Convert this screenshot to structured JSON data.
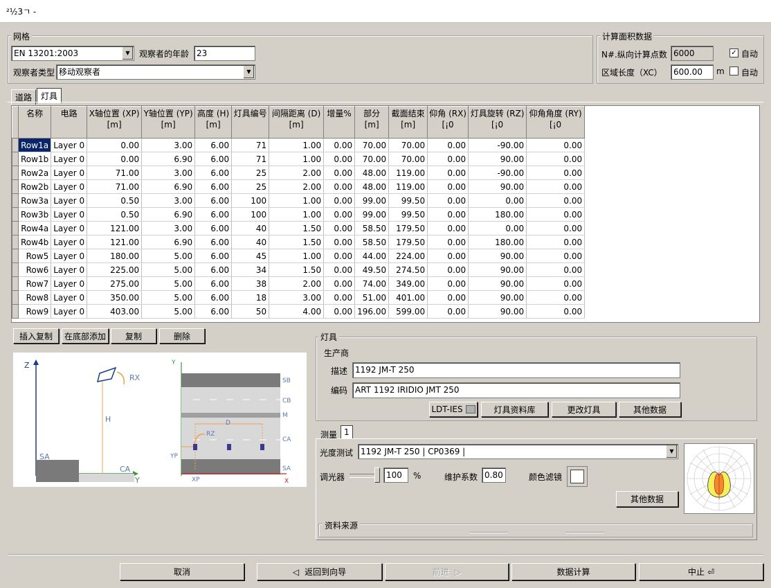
{
  "window": {
    "title": "²½3ㄱ -"
  },
  "grid_group": {
    "title": "网格",
    "standard": "EN 13201:2003",
    "observer_age_label": "观察者的年龄",
    "observer_age": "23",
    "observer_type_label": "观察者类型",
    "observer_type": "移动观察者"
  },
  "calc_group": {
    "title": "计算面积数据",
    "points_label": "N#.纵向计算点数",
    "points_value": "6000",
    "auto1": "自动",
    "auto1_checked": "✓",
    "length_label": "区域长度（XC）",
    "length_value": "600.00",
    "length_unit": "m",
    "auto2": "自动"
  },
  "tabs": [
    "道路",
    "灯具"
  ],
  "table": {
    "columns": [
      {
        "name": "名称",
        "unit": ""
      },
      {
        "name": "电路",
        "unit": ""
      },
      {
        "name": "X轴位置 (XP)",
        "unit": "[m]"
      },
      {
        "name": "Y轴位置 (YP)",
        "unit": "[m]"
      },
      {
        "name": "高度 (H)",
        "unit": "[m]"
      },
      {
        "name": "灯具编号",
        "unit": ""
      },
      {
        "name": "间隔距离 (D)",
        "unit": "[m]"
      },
      {
        "name": "增量%",
        "unit": ""
      },
      {
        "name": "部分",
        "unit": "[m]"
      },
      {
        "name": "截面结束",
        "unit": "[m]"
      },
      {
        "name": "仰角 (RX)",
        "unit": "[¡0"
      },
      {
        "name": "灯具旋转 (RZ)",
        "unit": "[¡0"
      },
      {
        "name": "仰角角度 (RY)",
        "unit": "[¡0"
      }
    ],
    "rows": [
      [
        "Row1a",
        "Layer 0",
        "0.00",
        "3.00",
        "6.00",
        "71",
        "1.00",
        "0.00",
        "70.00",
        "70.00",
        "0.00",
        "-90.00",
        "0.00"
      ],
      [
        "Row1b",
        "Layer 0",
        "0.00",
        "6.90",
        "6.00",
        "71",
        "1.00",
        "0.00",
        "70.00",
        "70.00",
        "0.00",
        "90.00",
        "0.00"
      ],
      [
        "Row2a",
        "Layer 0",
        "71.00",
        "3.00",
        "6.00",
        "25",
        "2.00",
        "0.00",
        "48.00",
        "119.00",
        "0.00",
        "-90.00",
        "0.00"
      ],
      [
        "Row2b",
        "Layer 0",
        "71.00",
        "6.90",
        "6.00",
        "25",
        "2.00",
        "0.00",
        "48.00",
        "119.00",
        "0.00",
        "90.00",
        "0.00"
      ],
      [
        "Row3a",
        "Layer 0",
        "0.50",
        "3.00",
        "6.00",
        "100",
        "1.00",
        "0.00",
        "99.00",
        "99.50",
        "0.00",
        "0.00",
        "0.00"
      ],
      [
        "Row3b",
        "Layer 0",
        "0.50",
        "6.90",
        "6.00",
        "100",
        "1.00",
        "0.00",
        "99.00",
        "99.50",
        "0.00",
        "180.00",
        "0.00"
      ],
      [
        "Row4a",
        "Layer 0",
        "121.00",
        "3.00",
        "6.00",
        "40",
        "1.50",
        "0.00",
        "58.50",
        "179.50",
        "0.00",
        "0.00",
        "0.00"
      ],
      [
        "Row4b",
        "Layer 0",
        "121.00",
        "6.90",
        "6.00",
        "40",
        "1.50",
        "0.00",
        "58.50",
        "179.50",
        "0.00",
        "180.00",
        "0.00"
      ],
      [
        "Row5",
        "Layer 0",
        "180.00",
        "5.00",
        "6.00",
        "45",
        "1.00",
        "0.00",
        "44.00",
        "224.00",
        "0.00",
        "90.00",
        "0.00"
      ],
      [
        "Row6",
        "Layer 0",
        "225.00",
        "5.00",
        "6.00",
        "34",
        "1.50",
        "0.00",
        "49.50",
        "274.50",
        "0.00",
        "90.00",
        "0.00"
      ],
      [
        "Row7",
        "Layer 0",
        "275.00",
        "5.00",
        "6.00",
        "38",
        "2.00",
        "0.00",
        "74.00",
        "349.00",
        "0.00",
        "90.00",
        "0.00"
      ],
      [
        "Row8",
        "Layer 0",
        "350.00",
        "5.00",
        "6.00",
        "18",
        "3.00",
        "0.00",
        "51.00",
        "401.00",
        "0.00",
        "90.00",
        "0.00"
      ],
      [
        "Row9",
        "Layer 0",
        "403.00",
        "5.00",
        "6.00",
        "50",
        "4.00",
        "0.00",
        "196.00",
        "599.00",
        "0.00",
        "90.00",
        "0.00"
      ]
    ]
  },
  "row_buttons": [
    "插入复制",
    "在底部添加",
    "复制",
    "删除"
  ],
  "diagram": {
    "side_labels": [
      "Z",
      "RX",
      "H",
      "SA",
      "CA",
      "Y"
    ],
    "plan_labels": [
      "Y",
      "SB",
      "CB",
      "M",
      "D",
      "RZ",
      "CA",
      "YP",
      "SA",
      "XP",
      "X"
    ]
  },
  "luminaire": {
    "title": "灯具",
    "manufacturer_label": "生产商",
    "desc_label": "描述",
    "desc_value": "1192 JM-T 250",
    "code_label": "编码",
    "code_value": "ART 1192 IRIDIO JMT 250",
    "buttons": [
      "LDT-IES",
      "灯具资料库",
      "更改灯具",
      "其他数据"
    ]
  },
  "measure": {
    "tabs": [
      "测量",
      "1"
    ],
    "photometry_label": "光度测试",
    "photometry_value": "1192 JM-T 250 | CP0369 |",
    "dimmer_label": "调光器",
    "dimmer_value": "100",
    "dimmer_unit": "%",
    "maint_label": "维护系数",
    "maint_value": "0.80",
    "color_filter_label": "颜色滤镜",
    "other_data": "其他数据",
    "source_label": "资料来源"
  },
  "footer": {
    "cancel": "取消",
    "back": "返回到向导",
    "next": "前进",
    "calc": "数据计算",
    "stop": "中止"
  }
}
